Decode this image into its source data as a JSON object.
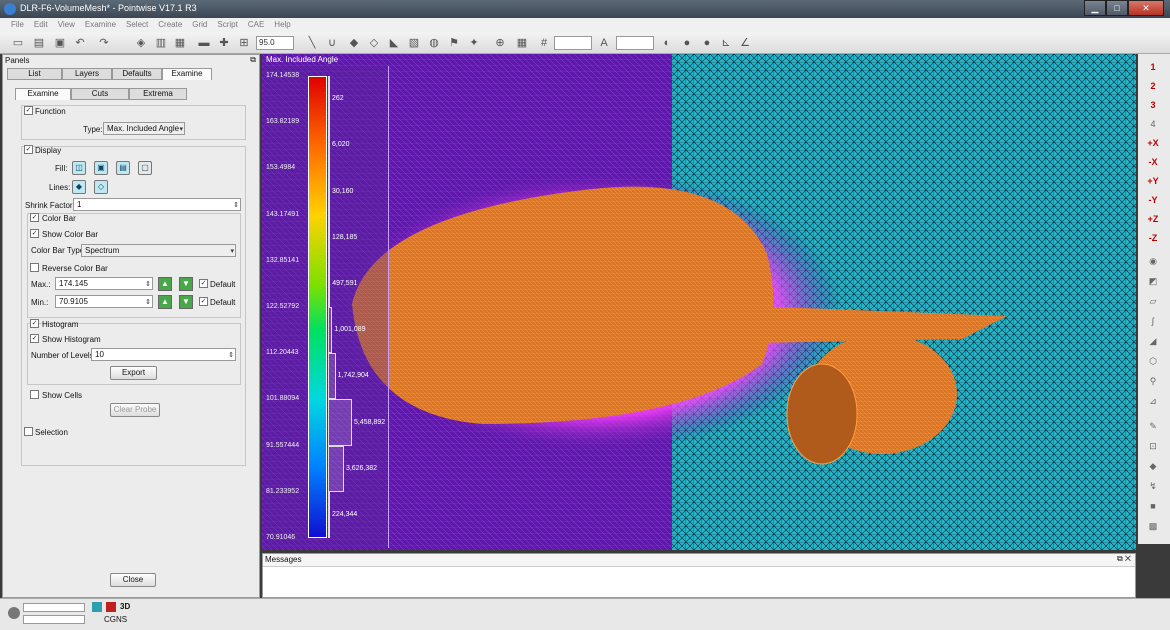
{
  "window": {
    "title": "DLR-F6-VolumeMesh* - Pointwise V17.1 R3",
    "min": "▁",
    "max": "□",
    "close": "✕"
  },
  "menu": [
    "File",
    "Edit",
    "View",
    "Examine",
    "Select",
    "Create",
    "Grid",
    "Script",
    "CAE",
    "Help"
  ],
  "toolbar": {
    "angle_value": "95.0"
  },
  "panel": {
    "title": "Panels",
    "tabs": [
      "List",
      "Layers",
      "Defaults",
      "Examine"
    ],
    "subtabs": [
      "Examine",
      "Cuts",
      "Extrema"
    ],
    "function_label": "Function",
    "type_label": "Type:",
    "type_value": "Max. Included Angle",
    "display_label": "Display",
    "fill_label": "Fill:",
    "lines_label": "Lines:",
    "shrink_label": "Shrink Factor:",
    "shrink_value": "1",
    "color_bar_label": "Color Bar",
    "show_color_bar_label": "Show Color Bar",
    "color_bar_type_label": "Color Bar Type:",
    "color_bar_type_value": "Spectrum",
    "reverse_label": "Reverse Color Bar",
    "max_label": "Max.:",
    "max_value": "174.145",
    "min_label": "Min.:",
    "min_value": "70.9105",
    "default_label": "Default",
    "histogram_label": "Histogram",
    "show_histogram_label": "Show Histogram",
    "levels_label": "Number of Levels:",
    "levels_value": "10",
    "export_label": "Export",
    "show_cells_label": "Show Cells",
    "clear_probe_label": "Clear Probe",
    "selection_label": "Selection",
    "close_label": "Close"
  },
  "viewport": {
    "title": "Max. Included Angle",
    "ticks": [
      "174.14538",
      "163.82189",
      "153.4984",
      "143.17491",
      "132.85141",
      "122.52792",
      "112.20443",
      "101.88094",
      "91.557444",
      "81.233952",
      "70.91046"
    ],
    "histogram": [
      "262",
      "6,020",
      "30,160",
      "128,185",
      "497,591",
      "1,001,089",
      "1,742,904",
      "5,458,892",
      "3,626,382",
      "224,344"
    ],
    "histogram_values": [
      262,
      6020,
      30160,
      128185,
      497591,
      1001089,
      1742904,
      5458892,
      3626382,
      224344
    ]
  },
  "messages": {
    "title": "Messages"
  },
  "status": {
    "mode": "3D",
    "solver": "CGNS"
  },
  "rightbar": [
    "1",
    "2",
    "3",
    "4",
    "+X",
    "-X",
    "+Y",
    "-Y",
    "+Z",
    "-Z"
  ]
}
